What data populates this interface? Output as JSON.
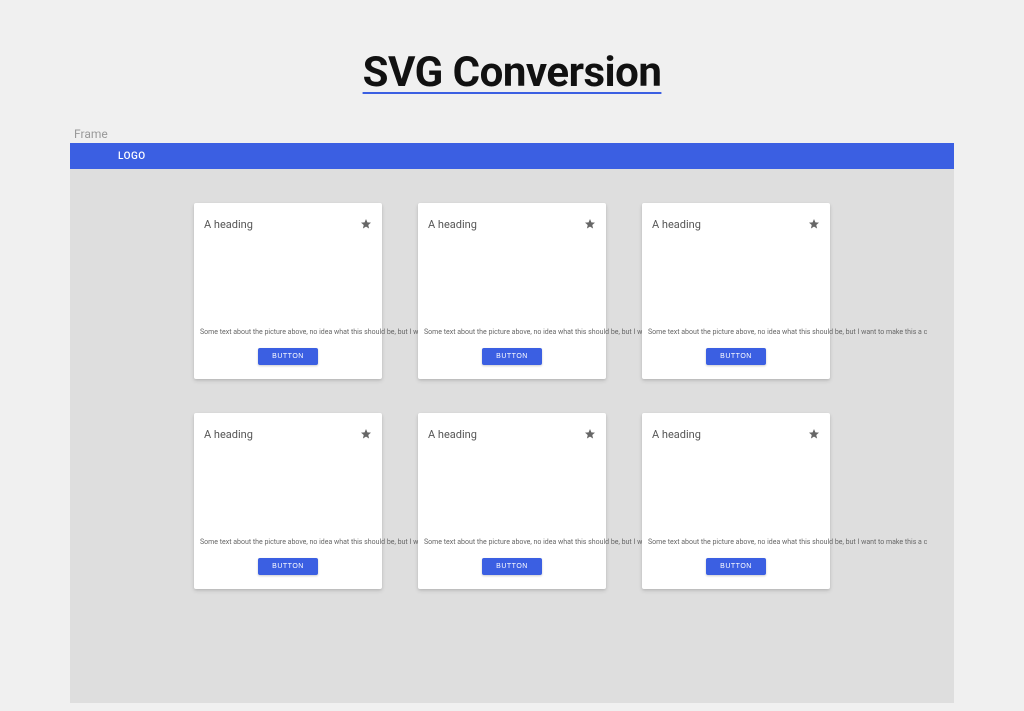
{
  "page": {
    "title": "SVG Conversion"
  },
  "frame": {
    "label": "Frame",
    "topbar": {
      "logo": "LOGO"
    }
  },
  "cards": [
    {
      "heading": "A heading",
      "text": "Some text about the picture above, no idea what this should be, but I want to make this a c",
      "button": "BUTTON"
    },
    {
      "heading": "A heading",
      "text": "Some text about the picture above, no idea what this should be, but I want to make this a c",
      "button": "BUTTON"
    },
    {
      "heading": "A heading",
      "text": "Some text about the picture above, no idea what this should be, but I want to make this a c",
      "button": "BUTTON"
    },
    {
      "heading": "A heading",
      "text": "Some text about the picture above, no idea what this should be, but I want to make this a c",
      "button": "BUTTON"
    },
    {
      "heading": "A heading",
      "text": "Some text about the picture above, no idea what this should be, but I want to make this a c",
      "button": "BUTTON"
    },
    {
      "heading": "A heading",
      "text": "Some text about the picture above, no idea what this should be, but I want to make this a c",
      "button": "BUTTON"
    }
  ]
}
